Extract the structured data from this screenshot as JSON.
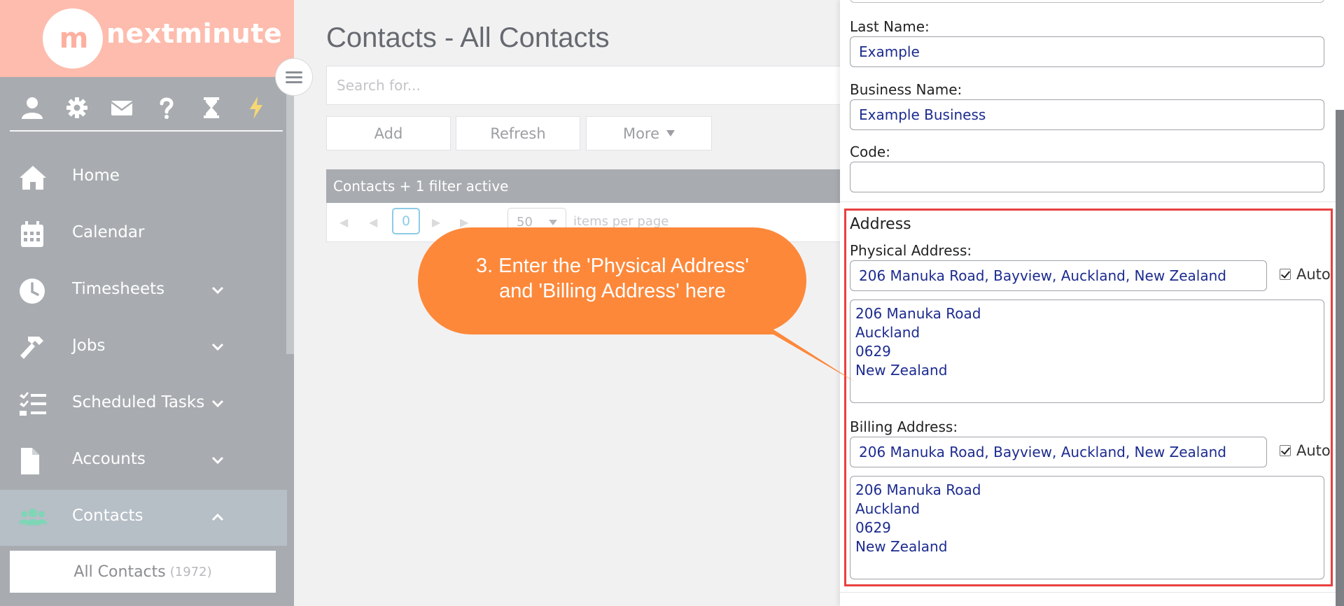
{
  "brand": {
    "logo_mark": "m",
    "name": "nextminute"
  },
  "sidebar": {
    "top_icons": [
      "user-icon",
      "gear-icon",
      "envelope-icon",
      "question-icon",
      "hourglass-icon",
      "bolt-icon"
    ],
    "accent_color": "#f7d774",
    "items": [
      {
        "label": "Home",
        "icon": "home-icon",
        "has_chevron": false
      },
      {
        "label": "Calendar",
        "icon": "calendar-icon",
        "has_chevron": false
      },
      {
        "label": "Timesheets",
        "icon": "clock-icon",
        "has_chevron": true
      },
      {
        "label": "Jobs",
        "icon": "hammer-icon",
        "has_chevron": true
      },
      {
        "label": "Scheduled Tasks",
        "icon": "tasks-icon",
        "has_chevron": true
      },
      {
        "label": "Accounts",
        "icon": "document-icon",
        "has_chevron": true
      },
      {
        "label": "Contacts",
        "icon": "users-icon",
        "has_chevron": true,
        "active": true
      }
    ],
    "sub_item": {
      "label": "All Contacts",
      "count": "(1972)"
    }
  },
  "main": {
    "title": "Contacts - All Contacts",
    "search_placeholder": "Search for...",
    "buttons": {
      "add": "Add",
      "refresh": "Refresh",
      "more": "More"
    },
    "grid_header": "Contacts + 1 filter active",
    "pager": {
      "page": "0",
      "page_size": "50",
      "items_per_page": "items per page"
    }
  },
  "callout": {
    "line1": "3. Enter the 'Physical Address'",
    "line2": "and 'Billing Address' here",
    "color": "#fd883a"
  },
  "panel": {
    "last_name_label": "Last Name:",
    "last_name_value": "Example",
    "business_name_label": "Business Name:",
    "business_name_value": "Example Business",
    "code_label": "Code:",
    "code_value": "",
    "address_title": "Address",
    "physical_label": "Physical Address:",
    "physical_value": "206 Manuka Road, Bayview, Auckland, New Zealand",
    "physical_lines": [
      "206 Manuka Road",
      "Auckland",
      "0629",
      "New Zealand"
    ],
    "billing_label": "Billing Address:",
    "billing_value": "206 Manuka Road, Bayview, Auckland, New Zealand",
    "billing_lines": [
      "206 Manuka Road",
      "Auckland",
      "0629",
      "New Zealand"
    ],
    "auto_label": "Auto",
    "highlight_color": "#e8403f"
  }
}
